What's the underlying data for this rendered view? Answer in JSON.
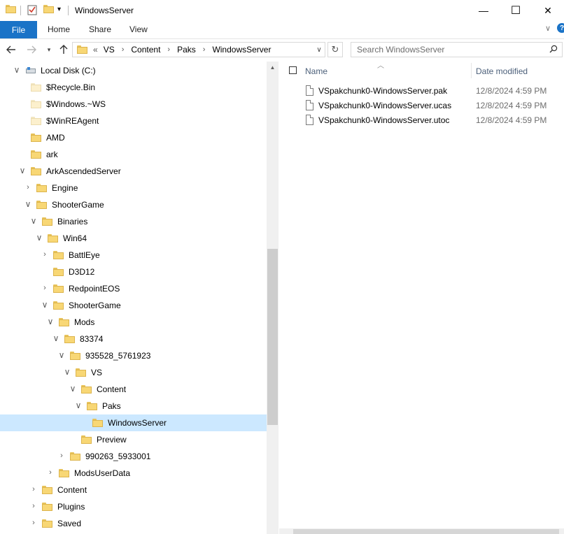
{
  "window": {
    "title": "WindowsServer",
    "minimize_glyph": "—",
    "maximize_glyph": "☐",
    "close_glyph": "✕"
  },
  "ribbon": {
    "tabs": [
      "File",
      "Home",
      "Share",
      "View"
    ]
  },
  "address_bar": {
    "overflow": "«",
    "breadcrumbs": [
      "VS",
      "Content",
      "Paks",
      "WindowsServer"
    ]
  },
  "search": {
    "placeholder": "Search WindowsServer"
  },
  "nav_tree": [
    {
      "label": "Local Disk (C:)",
      "depth": 0,
      "state": "expanded",
      "icon": "drive-icon"
    },
    {
      "label": "$Recycle.Bin",
      "depth": 1,
      "state": "none",
      "icon": "folder-icon-hidden"
    },
    {
      "label": "$Windows.~WS",
      "depth": 1,
      "state": "none",
      "icon": "folder-icon-hidden"
    },
    {
      "label": "$WinREAgent",
      "depth": 1,
      "state": "none",
      "icon": "folder-icon-hidden"
    },
    {
      "label": "AMD",
      "depth": 1,
      "state": "none",
      "icon": "folder-icon"
    },
    {
      "label": "ark",
      "depth": 1,
      "state": "none",
      "icon": "folder-icon"
    },
    {
      "label": "ArkAscendedServer",
      "depth": 1,
      "state": "expanded",
      "icon": "folder-icon"
    },
    {
      "label": "Engine",
      "depth": 2,
      "state": "collapsed",
      "icon": "folder-icon"
    },
    {
      "label": "ShooterGame",
      "depth": 2,
      "state": "expanded",
      "icon": "folder-icon"
    },
    {
      "label": "Binaries",
      "depth": 3,
      "state": "expanded",
      "icon": "folder-icon"
    },
    {
      "label": "Win64",
      "depth": 4,
      "state": "expanded",
      "icon": "folder-icon"
    },
    {
      "label": "BattlEye",
      "depth": 5,
      "state": "collapsed",
      "icon": "folder-icon"
    },
    {
      "label": "D3D12",
      "depth": 5,
      "state": "none",
      "icon": "folder-icon"
    },
    {
      "label": "RedpointEOS",
      "depth": 5,
      "state": "collapsed",
      "icon": "folder-icon"
    },
    {
      "label": "ShooterGame",
      "depth": 5,
      "state": "expanded",
      "icon": "folder-icon"
    },
    {
      "label": "Mods",
      "depth": 6,
      "state": "expanded",
      "icon": "folder-icon"
    },
    {
      "label": "83374",
      "depth": 7,
      "state": "expanded",
      "icon": "folder-icon"
    },
    {
      "label": "935528_5761923",
      "depth": 8,
      "state": "expanded",
      "icon": "folder-icon"
    },
    {
      "label": "VS",
      "depth": 9,
      "state": "expanded",
      "icon": "folder-icon"
    },
    {
      "label": "Content",
      "depth": 10,
      "state": "expanded",
      "icon": "folder-icon"
    },
    {
      "label": "Paks",
      "depth": 11,
      "state": "expanded",
      "icon": "folder-icon"
    },
    {
      "label": "WindowsServer",
      "depth": 12,
      "state": "none",
      "icon": "folder-icon",
      "selected": true
    },
    {
      "label": "Preview",
      "depth": 10,
      "state": "none",
      "icon": "folder-icon"
    },
    {
      "label": "990263_5933001",
      "depth": 8,
      "state": "collapsed",
      "icon": "folder-icon"
    },
    {
      "label": "ModsUserData",
      "depth": 6,
      "state": "collapsed",
      "icon": "folder-icon"
    },
    {
      "label": "Content",
      "depth": 3,
      "state": "collapsed",
      "icon": "folder-icon"
    },
    {
      "label": "Plugins",
      "depth": 3,
      "state": "collapsed",
      "icon": "folder-icon"
    },
    {
      "label": "Saved",
      "depth": 3,
      "state": "collapsed",
      "icon": "folder-icon"
    }
  ],
  "file_list": {
    "columns": [
      "Name",
      "Date modified"
    ],
    "files": [
      {
        "name": "VSpakchunk0-WindowsServer.pak",
        "date": "12/8/2024 4:59 PM"
      },
      {
        "name": "VSpakchunk0-WindowsServer.ucas",
        "date": "12/8/2024 4:59 PM"
      },
      {
        "name": "VSpakchunk0-WindowsServer.utoc",
        "date": "12/8/2024 4:59 PM"
      }
    ]
  }
}
